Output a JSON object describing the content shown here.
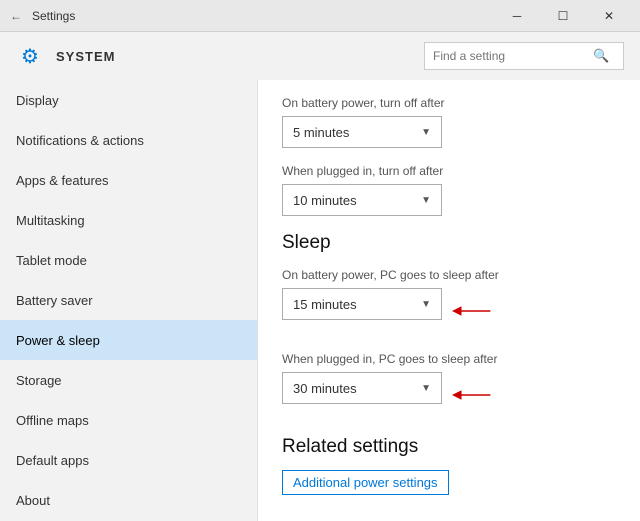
{
  "titleBar": {
    "title": "Settings",
    "minimizeLabel": "─",
    "maximizeLabel": "☐",
    "closeLabel": "✕"
  },
  "header": {
    "gearIcon": "⚙",
    "systemLabel": "SYSTEM",
    "searchPlaceholder": "Find a setting",
    "searchIcon": "🔍"
  },
  "sidebar": {
    "items": [
      {
        "label": "Display",
        "active": false
      },
      {
        "label": "Notifications & actions",
        "active": false
      },
      {
        "label": "Apps & features",
        "active": false
      },
      {
        "label": "Multitasking",
        "active": false
      },
      {
        "label": "Tablet mode",
        "active": false
      },
      {
        "label": "Battery saver",
        "active": false
      },
      {
        "label": "Power & sleep",
        "active": true
      },
      {
        "label": "Storage",
        "active": false
      },
      {
        "label": "Offline maps",
        "active": false
      },
      {
        "label": "Default apps",
        "active": false
      },
      {
        "label": "About",
        "active": false
      }
    ]
  },
  "content": {
    "screenOffBatteryLabel": "On battery power, turn off after",
    "screenOffBatteryValue": "5 minutes",
    "screenOffPluggedLabel": "When plugged in, turn off after",
    "screenOffPluggedValue": "10 minutes",
    "sleepSectionTitle": "Sleep",
    "sleepBatteryLabel": "On battery power, PC goes to sleep after",
    "sleepBatteryValue": "15 minutes",
    "sleepPluggedLabel": "When plugged in, PC goes to sleep after",
    "sleepPluggedValue": "30 minutes",
    "relatedSettingsTitle": "Related settings",
    "additionalPowerLink": "Additional power settings"
  }
}
